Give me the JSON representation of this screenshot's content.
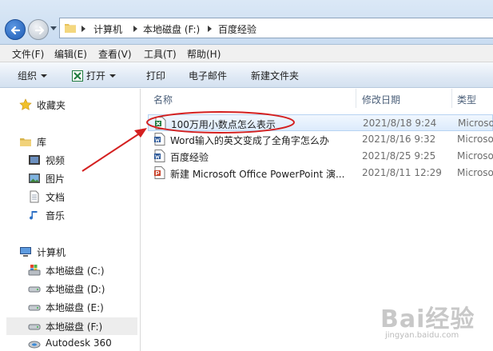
{
  "address": {
    "crumbs": [
      "计算机",
      "本地磁盘 (F:)",
      "百度经验"
    ]
  },
  "menu": [
    "文件(F)",
    "编辑(E)",
    "查看(V)",
    "工具(T)",
    "帮助(H)"
  ],
  "toolbar": {
    "organize": "组织",
    "open": "打开",
    "print": "打印",
    "email": "电子邮件",
    "new_folder": "新建文件夹"
  },
  "sidebar": {
    "favorites": "收藏夹",
    "library": "库",
    "library_items": [
      "视频",
      "图片",
      "文档",
      "音乐"
    ],
    "computer": "计算机",
    "drives": [
      "本地磁盘 (C:)",
      "本地磁盘 (D:)",
      "本地磁盘 (E:)",
      "本地磁盘 (F:)",
      "Autodesk 360"
    ]
  },
  "columns": {
    "name": "名称",
    "modified": "修改日期",
    "type": "类型"
  },
  "files": [
    {
      "name": "100万用小数点怎么表示",
      "date": "2021/8/18 9:24",
      "type": "Microso",
      "icon": "excel-file-icon"
    },
    {
      "name": "Word输入的英文变成了全角字怎么办",
      "date": "2021/8/16 9:32",
      "type": "Microso",
      "icon": "word-file-icon"
    },
    {
      "name": "百度经验",
      "date": "2021/8/25 9:25",
      "type": "Microso",
      "icon": "word-file-icon"
    },
    {
      "name": "新建 Microsoft Office PowerPoint 演...",
      "date": "2021/8/11 12:29",
      "type": "Microso",
      "icon": "powerpoint-file-icon"
    }
  ],
  "watermark": {
    "logo": "Bai经验",
    "url": "jingyan.baidu.com"
  },
  "colors": {
    "annotation": "#d42020",
    "selection": "#dcebfc",
    "excel_green": "#1f7a3e",
    "word_blue": "#2b5797",
    "ppt_red": "#c8432b"
  }
}
